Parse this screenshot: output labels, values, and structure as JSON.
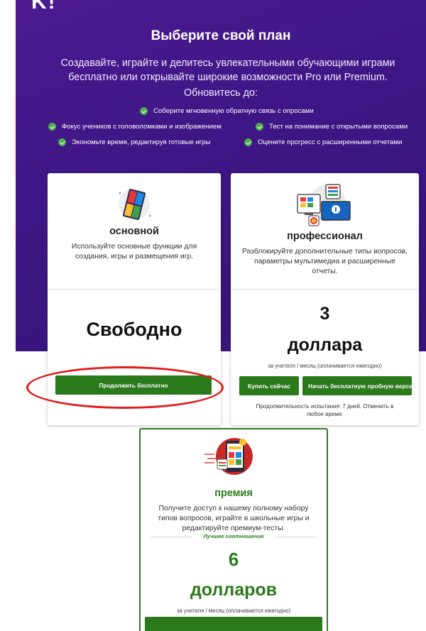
{
  "header": {
    "logo_fragment": "K!",
    "title": "Выберите свой план",
    "subtitle_line1": "Создавайте, играйте и делитесь увлекательными обучающими играми",
    "subtitle_line2": "бесплатно или открывайте широкие возможности Pro или Premium.",
    "upgrade_to": "Обновитесь до:",
    "features": [
      "Соберите мгновенную обратную связь с опросами",
      "Фокус учеников с головоломками и изображением",
      "Тест на понимание с открытыми вопросами",
      "Экономьте время, редактируя готовые игры",
      "Оцените прогресс с расширенными отчетами"
    ]
  },
  "plans": {
    "basic": {
      "title": "основной",
      "desc_line1": "Используйте основные функции для",
      "desc_line2": "создания, игры и размещения игр.",
      "price": "Свободно",
      "cta": "Продолжить бесплатно"
    },
    "pro": {
      "title": "профессионал",
      "desc_line1": "Разблокируйте дополнительные типы вопросов,",
      "desc_line2": "параметры мультимедиа и расширенные",
      "desc_line3": "отчеты.",
      "price_amount": "3",
      "price_unit": "доллара",
      "billing": "за учителя / месяц (оплачивается ежегодно)",
      "buy_cta": "Купить сейчас",
      "trial_cta": "Начать бесплатную пробную версию",
      "trial_note_line1": "Продолжительность испытания: 7 дней. Отменить в",
      "trial_note_line2": "любое время."
    },
    "premium": {
      "title": "премия",
      "desc_line1": "Получите доступ к нашему полному набору",
      "desc_line2": "типов вопросов, играйте в школьные игры и",
      "desc_line3": "редактируйте премиум-тесты.",
      "best_value": "Лучшее соотношение",
      "price_amount": "6",
      "price_unit": "долларов",
      "billing": "за учителя / месяц (оплачивается ежегодно)"
    }
  },
  "colors": {
    "hero_bg": "#3e1685",
    "button_green": "#2a7a1c",
    "premium_accent": "#2e7d1f",
    "highlight_red": "#e41a1a"
  }
}
